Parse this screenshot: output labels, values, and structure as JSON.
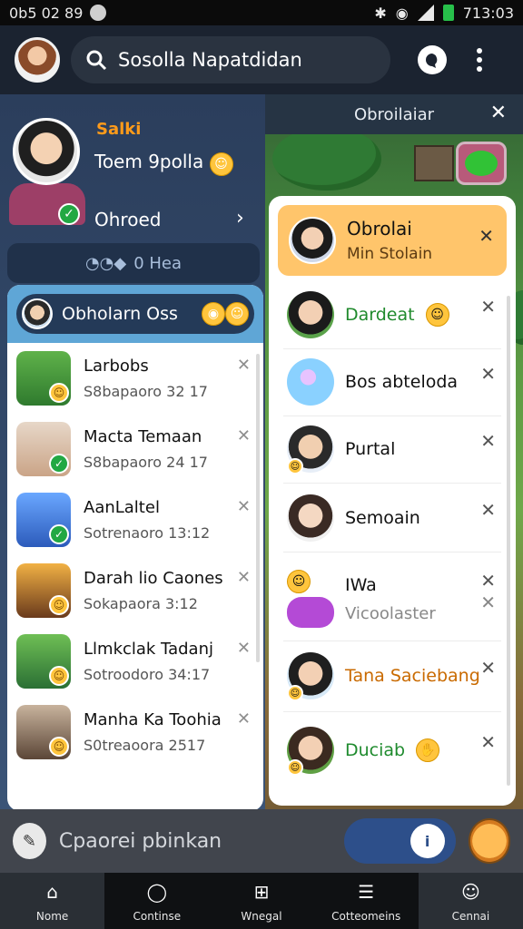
{
  "statusbar": {
    "time_left": "0b5 02 89",
    "time_right": "713:03"
  },
  "appbar": {
    "search_text": "Sosolla Napatdidan"
  },
  "left": {
    "profile": {
      "name": "Salki",
      "subtitle": "Toem 9polla",
      "status": "Ohroed"
    },
    "pill": {
      "label": "0 Hea"
    },
    "group": {
      "title": "Obholarn Oss"
    },
    "chats": [
      {
        "title": "Larbobs",
        "sub": "S8bapaoro 32 17"
      },
      {
        "title": "Macta Temaan",
        "sub": "S8bapaoro 24 17"
      },
      {
        "title": "AanLaltel",
        "sub": "Sotrenaoro 13:12"
      },
      {
        "title": "Darah lio Caones",
        "sub": "Sokapaora 3:12"
      },
      {
        "title": "Llmkclak Tadanj",
        "sub": "Sotroodoro 34:17"
      },
      {
        "title": "Manha Ka Toohia",
        "sub": "S0treaoora 2517"
      }
    ]
  },
  "right": {
    "header": {
      "title": "Obroilaiar"
    },
    "active": {
      "title": "Obrolai",
      "sub": "Min Stolain"
    },
    "items": [
      {
        "label": "Dardeat"
      },
      {
        "label": "Bos abteloda"
      },
      {
        "label": "Purtal"
      },
      {
        "label": "Semoain"
      },
      {
        "label": "IWa",
        "sub": "Vicoolaster"
      },
      {
        "label": "Tana Saciebang"
      },
      {
        "label": "Duciab"
      }
    ]
  },
  "composer": {
    "placeholder": "Cpaorei pbinkan"
  },
  "nav": [
    {
      "label": "Nome"
    },
    {
      "label": "Continse"
    },
    {
      "label": "Wnegal"
    },
    {
      "label": "Cotteomeins"
    },
    {
      "label": "Cennai"
    }
  ],
  "colors": {
    "accent_orange": "#ffc56b",
    "online_green": "#22a843",
    "header_blue": "#5fa6d6"
  }
}
